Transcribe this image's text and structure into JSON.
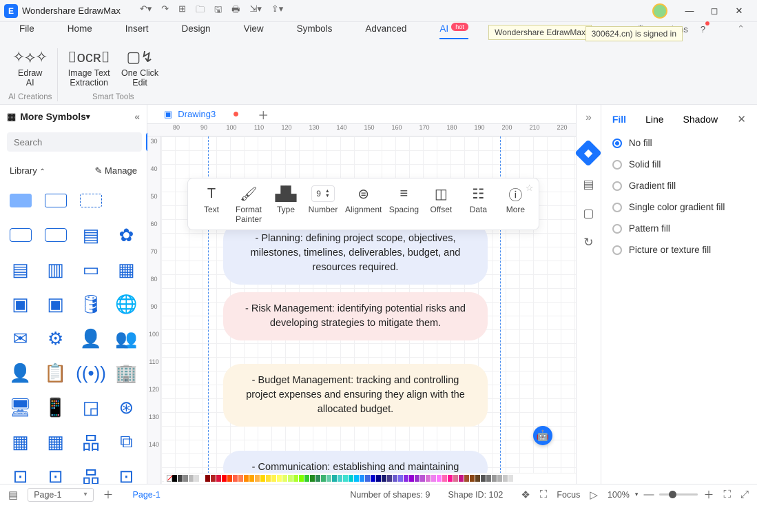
{
  "app": {
    "name": "Wondershare EdrawMax"
  },
  "tooltip": {
    "app": "Wondershare EdrawMax",
    "signin": "300624.cn) is signed in"
  },
  "menubar": {
    "tabs": [
      "File",
      "Home",
      "Insert",
      "Design",
      "View",
      "Symbols",
      "Advanced",
      "AI"
    ],
    "active": "AI",
    "hot_label": "hot",
    "right": {
      "options": "Options"
    }
  },
  "ribbon": {
    "edraw_ai": "Edraw\nAI",
    "img_text": "Image Text\nExtraction",
    "one_click": "One Click\nEdit",
    "group1": "AI Creations",
    "group2": "Smart Tools"
  },
  "sidebar": {
    "title": "More Symbols",
    "search_placeholder": "Search",
    "search_btn": "Search",
    "library": "Library",
    "manage": "Manage"
  },
  "doc": {
    "tab_name": "Drawing3"
  },
  "ruler_h": [
    "80",
    "90",
    "100",
    "110",
    "120",
    "130",
    "140",
    "150",
    "160",
    "170",
    "180",
    "190",
    "200",
    "210",
    "220"
  ],
  "ruler_v": [
    "30",
    "40",
    "50",
    "60",
    "70",
    "80",
    "90",
    "100",
    "110",
    "120",
    "130",
    "140"
  ],
  "float": {
    "text": "Text",
    "painter": "Format\nPainter",
    "type": "Type",
    "number_val": "9",
    "number": "Number",
    "alignment": "Alignment",
    "spacing": "Spacing",
    "offset": "Offset",
    "data": "Data",
    "more": "More"
  },
  "bubbles": {
    "b1": "- Planning: defining project scope, objectives, milestones, timelines, deliverables, budget, and resources required.",
    "b2": "- Risk Management: identifying potential risks and developing strategies to mitigate them.",
    "b3": "- Budget Management: tracking and controlling project expenses and ensuring they align with the allocated budget.",
    "b4": "- Communication: establishing and maintaining"
  },
  "panel": {
    "tabs": {
      "fill": "Fill",
      "line": "Line",
      "shadow": "Shadow"
    },
    "opts": {
      "nofill": "No fill",
      "solid": "Solid fill",
      "gradient": "Gradient fill",
      "single_gradient": "Single color gradient fill",
      "pattern": "Pattern fill",
      "picture": "Picture or texture fill"
    }
  },
  "status": {
    "page_label": "Page-1",
    "page_active": "Page-1",
    "shapes": "Number of shapes: 9",
    "shape_id": "Shape ID: 102",
    "focus": "Focus",
    "zoom": "100%"
  },
  "color_strip": [
    "#000",
    "#444",
    "#888",
    "#bbb",
    "#ddd",
    "#fff",
    "#8b0000",
    "#b22222",
    "#dc143c",
    "#ff0000",
    "#ff4500",
    "#ff6347",
    "#ff7f50",
    "#ff8c00",
    "#ffa500",
    "#ffb347",
    "#ffd700",
    "#ffe135",
    "#fff44f",
    "#ffff66",
    "#e6ff66",
    "#ccff66",
    "#adff2f",
    "#7fff00",
    "#32cd32",
    "#228b22",
    "#2e8b57",
    "#3cb371",
    "#66cdaa",
    "#20b2aa",
    "#48d1cc",
    "#40e0d0",
    "#00ced1",
    "#00bfff",
    "#1e90ff",
    "#4169e1",
    "#0000cd",
    "#00008b",
    "#191970",
    "#483d8b",
    "#6a5acd",
    "#7b68ee",
    "#8a2be2",
    "#9400d3",
    "#9932cc",
    "#ba55d3",
    "#da70d6",
    "#ee82ee",
    "#ff77ff",
    "#ff69b4",
    "#ff1493",
    "#db7093",
    "#c71585",
    "#a0522d",
    "#8b4513",
    "#654321",
    "#555",
    "#777",
    "#999",
    "#b0b0b0",
    "#c8c8c8",
    "#e0e0e0"
  ]
}
